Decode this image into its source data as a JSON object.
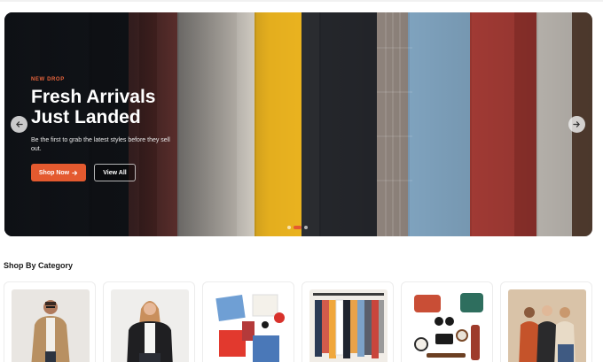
{
  "hero": {
    "eyebrow": "NEW DROP",
    "title_line1": "Fresh Arrivals",
    "title_line2": "Just Landed",
    "subtitle": "Be the first to grab the latest styles before they sell out.",
    "shop_now_label": "Shop Now",
    "shop_now_icon": "arrow-right-icon",
    "view_all_label": "View All",
    "prev_icon": "arrow-left-icon",
    "next_icon": "arrow-right-icon",
    "slides_count": 3,
    "active_slide": 2,
    "accent_color": "#e45a2f"
  },
  "categories": {
    "title": "Shop By Category",
    "items": [
      {
        "image": "man-in-jacket"
      },
      {
        "image": "woman-in-leather-jacket"
      },
      {
        "image": "flat-lay-clothes"
      },
      {
        "image": "clothes-rack"
      },
      {
        "image": "accessories-flat-lay"
      },
      {
        "image": "group-of-women"
      }
    ]
  }
}
